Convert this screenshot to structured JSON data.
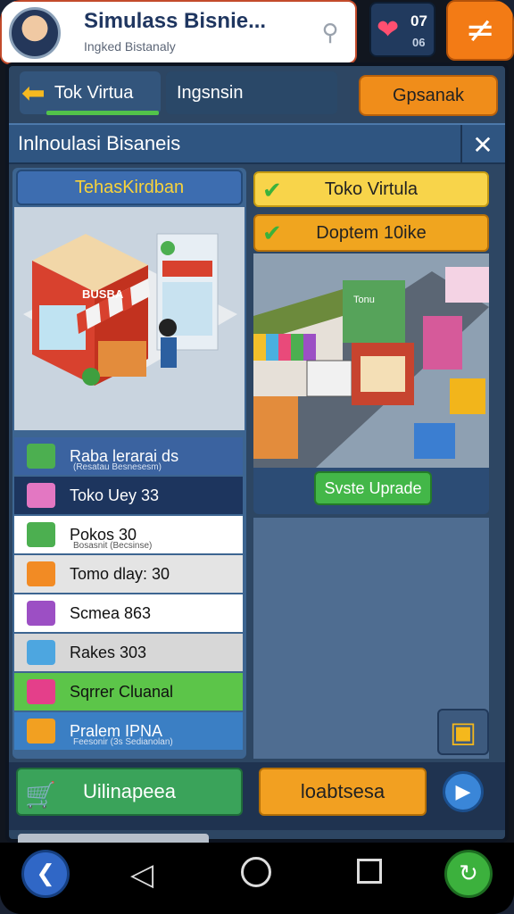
{
  "header": {
    "title": "Simulass Bisnie...",
    "subtitle": "Ingked Bistanaly",
    "count_top": "07",
    "count_bottom": "06"
  },
  "top_tabs": {
    "active_label": "Tok Virtua",
    "second_label": "Ingsnsin",
    "orange_label": "Gpsanak"
  },
  "window": {
    "title": "Inlnoulasi Bisaneis"
  },
  "left_panel": {
    "header": "TehasKirdban",
    "items": [
      {
        "name": "Raba lerarai ds",
        "sub": "(Resatau Besnesesm)",
        "bg": "#3b63a0",
        "fg": "#ffffff",
        "icon_color": "#4caf50"
      },
      {
        "name": "Toko Uey 33",
        "sub": "",
        "bg": "#1d355e",
        "fg": "#ffffff",
        "icon_color": "#e377c2"
      },
      {
        "name": "Pokos 30",
        "sub": "Bosasnit (Becsinse)",
        "bg": "#ffffff",
        "fg": "#111111",
        "icon_color": "#4caf50"
      },
      {
        "name": "Tomo dlay: 30",
        "sub": "",
        "bg": "#e4e4e4",
        "fg": "#111111",
        "icon_color": "#f28b24"
      },
      {
        "name": "Scmea 863",
        "sub": "",
        "bg": "#ffffff",
        "fg": "#111111",
        "icon_color": "#9c4fc4"
      },
      {
        "name": "Rakes 303",
        "sub": "",
        "bg": "#d7d7d7",
        "fg": "#111111",
        "icon_color": "#4da6e0"
      },
      {
        "name": "Sqrrer Cluanal",
        "sub": "",
        "bg": "#5cc549",
        "fg": "#111111",
        "icon_color": "#e43f8a"
      },
      {
        "name": "Pralem IPNA",
        "sub": "Feesonir (3s Sedianolan)",
        "bg": "#3b7fc4",
        "fg": "#ffffff",
        "icon_color": "#f2a021"
      }
    ]
  },
  "right_panel": {
    "yellow_label": "Toko Virtula",
    "orange_label": "Doptem 10ike",
    "upgrade_label": "Svste Uprade"
  },
  "shop_sign": "BUSBA",
  "street_sign": "Tonu",
  "actions": {
    "green_label": "Uilinapeea",
    "orange_label": "loabtsesa"
  },
  "colors": {
    "frame": "#2d4663",
    "accent_orange": "#f37b15",
    "accent_green": "#3aa35a"
  }
}
